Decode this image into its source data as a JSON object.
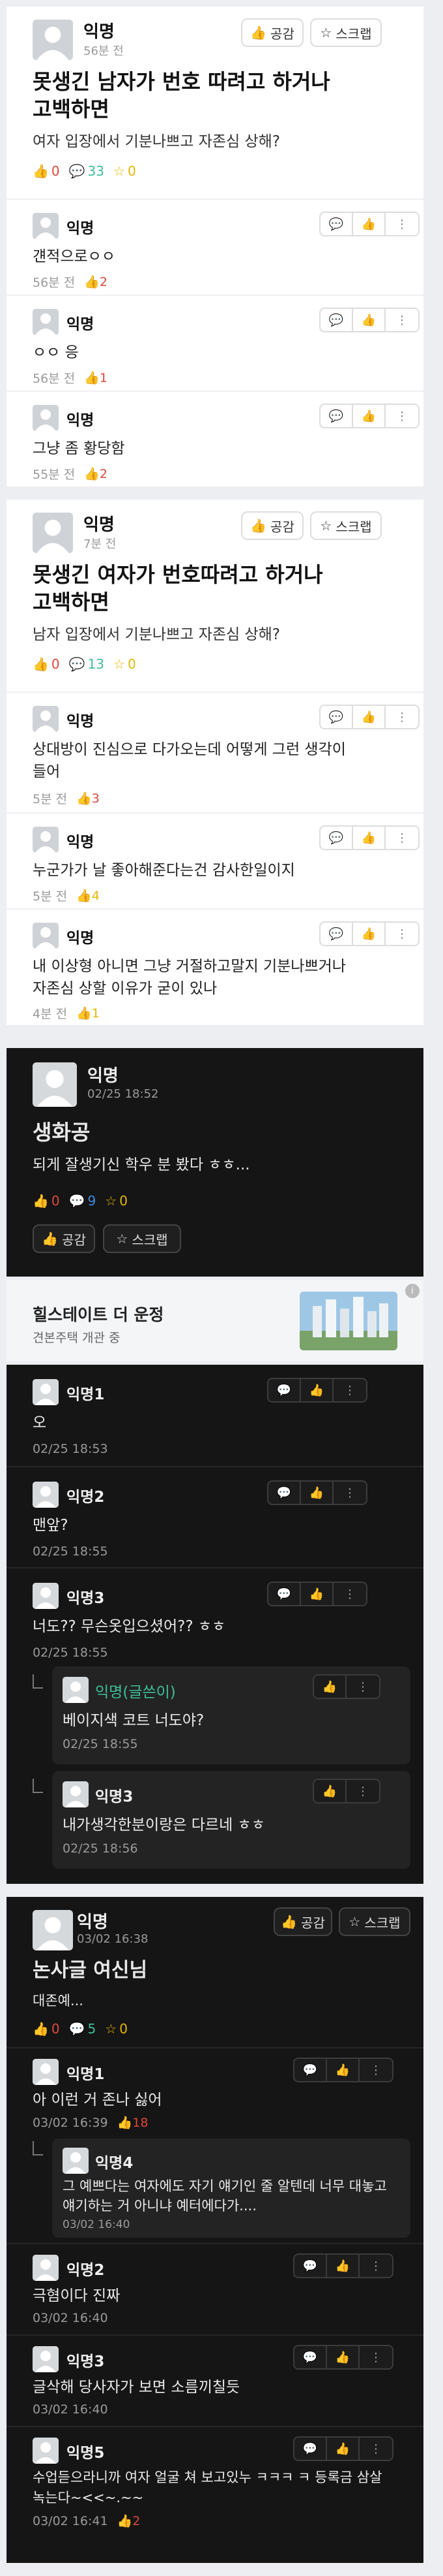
{
  "post1": {
    "author": "익명",
    "time": "56분 전",
    "like_label": "공감",
    "scrap_label": "스크랩",
    "title": "못생긴 남자가 번호 따려고 하거나\n고백하면",
    "body": "여자 입장에서 기분나쁘고 자존심 상해?",
    "likes": "0",
    "comments": "33",
    "scraps": "0",
    "comment_list": [
      {
        "author": "익명",
        "text": "걘적으로ㅇㅇ",
        "time": "56분 전",
        "likes": "2"
      },
      {
        "author": "익명",
        "text": "ㅇㅇ 응",
        "time": "56분 전",
        "likes": "1"
      },
      {
        "author": "익명",
        "text": "그냥 좀 황당함",
        "time": "55분 전",
        "likes": "2"
      }
    ]
  },
  "post2": {
    "author": "익명",
    "time": "7분 전",
    "like_label": "공감",
    "scrap_label": "스크랩",
    "title": "못생긴 여자가 번호따려고 하거나\n고백하면",
    "body": "남자 입장에서 기분나쁘고 자존심 상해?",
    "likes": "0",
    "comments": "13",
    "scraps": "0",
    "comment_list": [
      {
        "author": "익명",
        "text": "상대방이 진심으로 다가오는데 어떻게 그런 생각이\n들어",
        "time": "5분 전",
        "likes": "3"
      },
      {
        "author": "익명",
        "text": "누군가가 날 좋아해준다는건 감사한일이지",
        "time": "5분 전",
        "likes": "4"
      },
      {
        "author": "익명",
        "text": "내 이상형 아니면 그냥 거절하고말지 기분나쁘거나\n자존심 상할 이유가 굳이 있나",
        "time": "4분 전",
        "likes": "1"
      }
    ]
  },
  "post3": {
    "author": "익명",
    "time": "02/25 18:52",
    "title": "생화공",
    "body": "되게 잘생기신 학우 분 봤다 ㅎㅎ...",
    "likes": "0",
    "comments": "9",
    "scraps": "0",
    "like_label": "공감",
    "scrap_label": "스크랩",
    "ad": {
      "title": "힐스테이트 더 운정",
      "sub": "견본주택 개관 중"
    },
    "comment_list": [
      {
        "author": "익명1",
        "text": "오",
        "time": "02/25 18:53"
      },
      {
        "author": "익명2",
        "text": "맨앞?",
        "time": "02/25 18:55"
      },
      {
        "author": "익명3",
        "text": "너도?? 무슨옷입으셨어?? ㅎㅎ",
        "time": "02/25 18:55"
      }
    ],
    "replies": [
      {
        "author": "익명(글쓴이)",
        "text": "베이지색 코트 너도야?",
        "time": "02/25 18:55"
      },
      {
        "author": "익명3",
        "text": "내가생각한분이랑은 다르네 ㅎㅎ",
        "time": "02/25 18:56"
      }
    ]
  },
  "post4": {
    "author": "익명",
    "time": "03/02 16:38",
    "like_label": "공감",
    "scrap_label": "스크랩",
    "title": "논사글 여신님",
    "body": "대존예...",
    "likes": "0",
    "comments": "5",
    "scraps": "0",
    "comment_list": [
      {
        "author": "익명1",
        "text": "아 이런 거 존나 싫어",
        "time": "03/02 16:39",
        "likes": "18"
      },
      {
        "author": "익명2",
        "text": "극혐이다 진짜",
        "time": "03/02 16:40"
      },
      {
        "author": "익명3",
        "text": "글삭해 당사자가 보면 소름끼칠듯",
        "time": "03/02 16:40"
      },
      {
        "author": "익명5",
        "text": "수업듣으라니까 여자 얼굴 쳐 보고있누 ㅋㅋㅋ ㅋ 등록금 삼살\n녹는다~<<~.~~",
        "time": "03/02 16:41",
        "likes": "2"
      }
    ],
    "reply": {
      "author": "익명4",
      "text": "그 예쁘다는 여자에도 자기 얘기인 줄 알텐데 너무 대놓고\n얘기하는 거 아니냐 예터에다가....",
      "time": "03/02 16:40"
    }
  },
  "colors": {
    "like": "#e0483b",
    "comment": "#3fbf99",
    "scrap": "#e6b800",
    "dark_bg": "#151515",
    "light_bg": "#ffffff"
  }
}
